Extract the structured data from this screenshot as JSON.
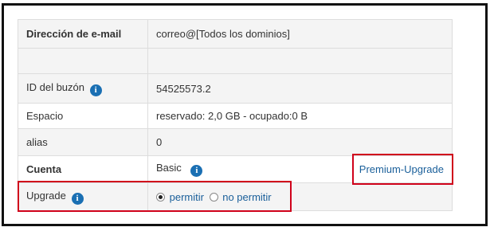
{
  "rows": {
    "email": {
      "label": "Dirección de e-mail",
      "value": "correo@[Todos los dominios]"
    },
    "mailbox_id": {
      "label": "ID del buzón",
      "value": "54525573.2"
    },
    "space": {
      "label": "Espacio",
      "value": "reservado: 2,0 GB - ocupado:0 B"
    },
    "alias": {
      "label": "alias",
      "value": "0"
    },
    "account": {
      "label": "Cuenta",
      "value": "Basic",
      "link": "Premium-Upgrade"
    },
    "upgrade": {
      "label": "Upgrade",
      "options": [
        {
          "label": "permitir",
          "checked": true
        },
        {
          "label": "no permitir",
          "checked": false
        }
      ]
    }
  },
  "icons": {
    "info": "info-icon",
    "info_glyph": "i"
  },
  "colors": {
    "link": "#1a5f9a",
    "highlight": "#d0021b",
    "info": "#1a6fb3"
  }
}
